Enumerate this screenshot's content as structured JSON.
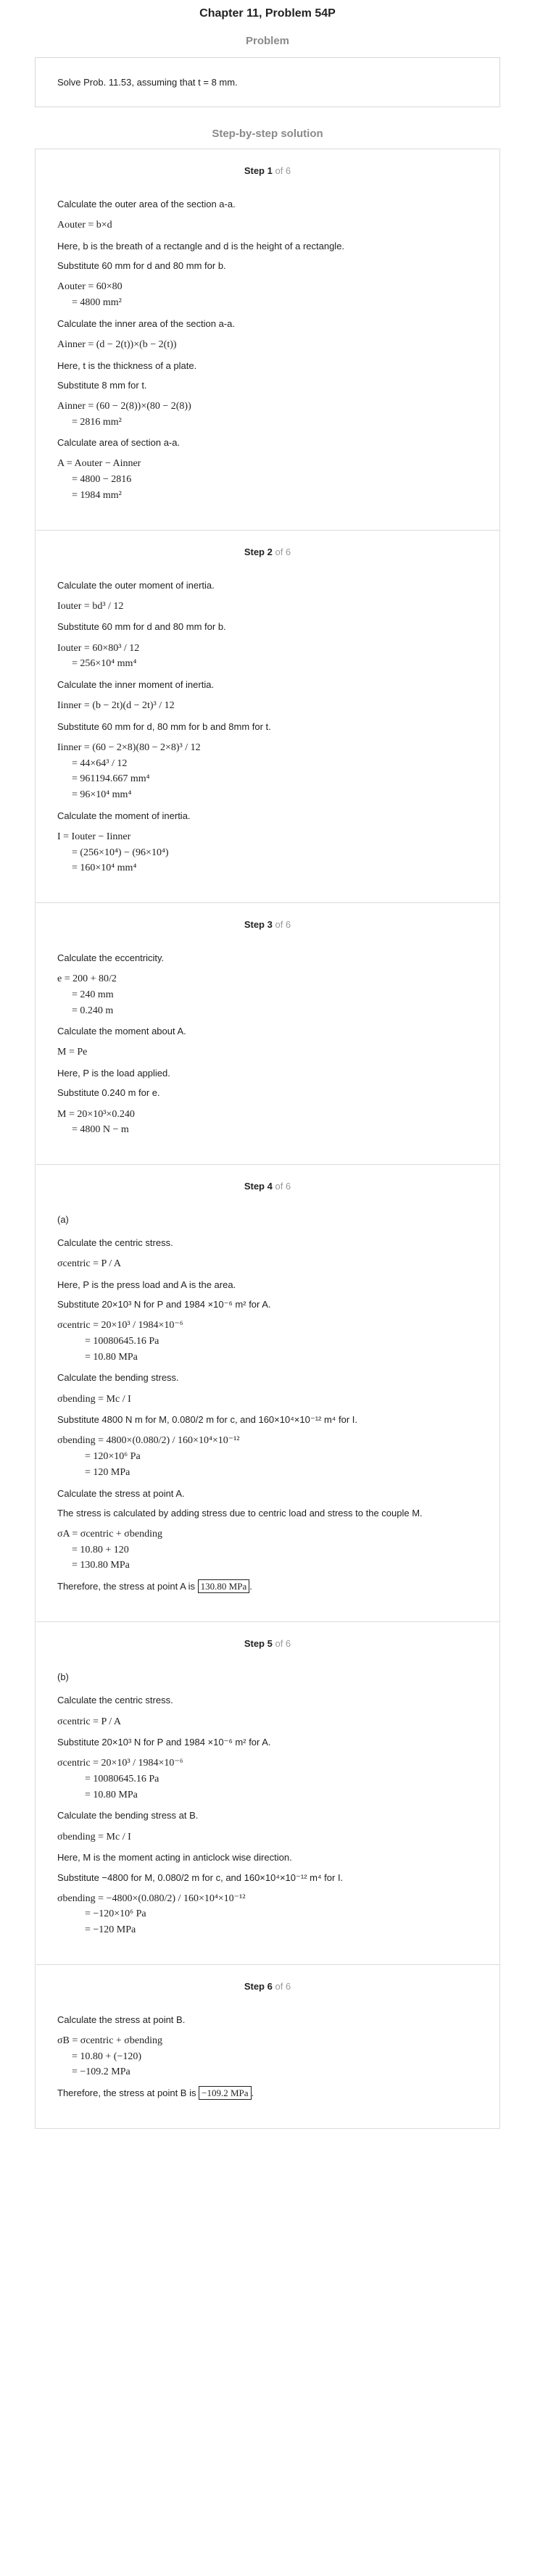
{
  "header": {
    "title": "Chapter 11, Problem 54P"
  },
  "problem": {
    "label": "Problem",
    "text": "Solve Prob. 11.53, assuming that t = 8 mm."
  },
  "solution_label": "Step-by-step solution",
  "steps": [
    {
      "num": "Step 1",
      "of": "of 6",
      "lines": [
        "Calculate the outer area of the section a-a.",
        "Aouter = b×d",
        "Here, b is the breath of a rectangle and d is the height of a rectangle.",
        "Substitute 60 mm for d and 80 mm for b.",
        "Aouter = 60×80",
        "= 4800 mm²",
        "Calculate the inner area of the section a-a.",
        "Ainner = (d − 2(t))×(b − 2(t))",
        "Here, t is the thickness of a plate.",
        "Substitute 8 mm for t.",
        "Ainner = (60 − 2(8))×(80 − 2(8))",
        "= 2816 mm²",
        "Calculate area of section a-a.",
        "A = Aouter − Ainner",
        "= 4800 − 2816",
        "= 1984 mm²"
      ]
    },
    {
      "num": "Step 2",
      "of": "of 6",
      "lines": [
        "Calculate the outer moment of inertia.",
        "Iouter = bd³ / 12",
        "Substitute 60 mm for d and 80 mm for b.",
        "Iouter = 60×80³ / 12",
        "= 256×10⁴ mm⁴",
        "Calculate the inner moment of inertia.",
        "Iinner = (b − 2t)(d − 2t)³ / 12",
        "Substitute 60 mm for d, 80 mm for b and 8mm for t.",
        "Iinner = (60 − 2×8)(80 − 2×8)³ / 12",
        "= 44×64³ / 12",
        "= 961194.667 mm⁴",
        "= 96×10⁴ mm⁴",
        "Calculate the moment of inertia.",
        "I = Iouter − Iinner",
        "= (256×10⁴) − (96×10⁴)",
        "= 160×10⁴ mm⁴"
      ]
    },
    {
      "num": "Step 3",
      "of": "of 6",
      "lines": [
        "Calculate the eccentricity.",
        "e = 200 + 80/2",
        "= 240 mm",
        "= 0.240 m",
        "Calculate the moment about A.",
        "M = Pe",
        "Here, P is the load applied.",
        "Substitute 0.240 m for e.",
        "M = 20×10³×0.240",
        "= 4800 N − m"
      ]
    },
    {
      "num": "Step 4",
      "of": "of 6",
      "lines": [
        "(a)",
        "Calculate the centric stress.",
        "σcentric = P / A",
        "Here, P is the press load and A is the area.",
        "Substitute 20×10³ N for P and 1984 ×10⁻⁶ m² for A.",
        "σcentric = 20×10³ / 1984×10⁻⁶",
        "= 10080645.16 Pa",
        "= 10.80 MPa",
        "Calculate the bending stress.",
        "σbending = Mc / I",
        "Substitute 4800 N m for M, 0.080/2 m for c, and 160×10⁴×10⁻¹² m⁴ for I.",
        "σbending = 4800×(0.080/2) / 160×10⁴×10⁻¹²",
        "= 120×10⁶ Pa",
        "= 120 MPa",
        "Calculate the stress at point A.",
        "The stress is calculated by adding stress due to centric load and stress to the couple M.",
        "σA = σcentric + σbending",
        "= 10.80 + 120",
        "= 130.80 MPa",
        "Therefore, the stress at point A is",
        "130.80 MPa"
      ]
    },
    {
      "num": "Step 5",
      "of": "of 6",
      "lines": [
        "(b)",
        "Calculate the centric stress.",
        "σcentric = P / A",
        "Substitute 20×10³ N for P and 1984 ×10⁻⁶ m² for A.",
        "σcentric = 20×10³ / 1984×10⁻⁶",
        "= 10080645.16 Pa",
        "= 10.80 MPa",
        "Calculate the bending stress at B.",
        "σbending = Mc / I",
        "Here, M is the moment acting in anticlock wise direction.",
        "Substitute −4800 for M, 0.080/2 m for c, and 160×10⁴×10⁻¹² m⁴ for I.",
        "σbending = −4800×(0.080/2) / 160×10⁴×10⁻¹²",
        "= −120×10⁶ Pa",
        "= −120 MPa"
      ]
    },
    {
      "num": "Step 6",
      "of": "of 6",
      "lines": [
        "Calculate the stress at point B.",
        "σB = σcentric + σbending",
        "= 10.80 + (−120)",
        "= −109.2 MPa",
        "Therefore, the stress at point B is",
        "−109.2 MPa"
      ]
    }
  ]
}
